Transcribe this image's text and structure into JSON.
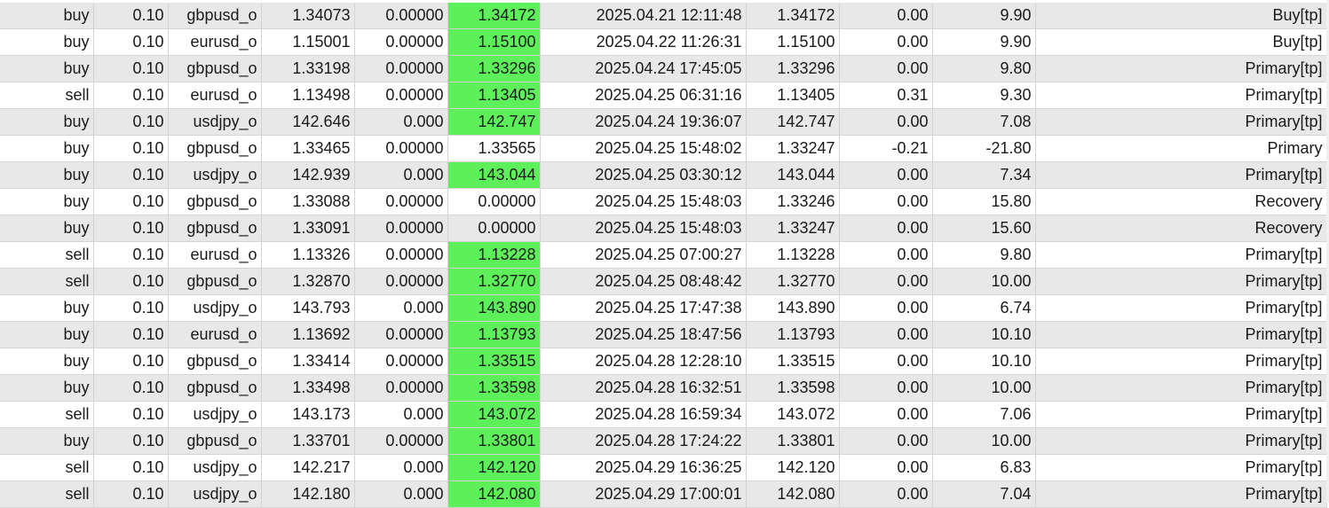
{
  "highlight_color": "#5ef05a",
  "rows": [
    {
      "type": "buy",
      "volume": "0.10",
      "symbol": "gbpusd_o",
      "price": "1.34073",
      "sl": "0.00000",
      "tp": "1.34172",
      "tp_hit": true,
      "time": "2025.04.21 12:11:48",
      "close_price": "1.34172",
      "swap": "0.00",
      "profit": "9.90",
      "comment": "Buy[tp]"
    },
    {
      "type": "buy",
      "volume": "0.10",
      "symbol": "eurusd_o",
      "price": "1.15001",
      "sl": "0.00000",
      "tp": "1.15100",
      "tp_hit": true,
      "time": "2025.04.22 11:26:31",
      "close_price": "1.15100",
      "swap": "0.00",
      "profit": "9.90",
      "comment": "Buy[tp]"
    },
    {
      "type": "buy",
      "volume": "0.10",
      "symbol": "gbpusd_o",
      "price": "1.33198",
      "sl": "0.00000",
      "tp": "1.33296",
      "tp_hit": true,
      "time": "2025.04.24 17:45:05",
      "close_price": "1.33296",
      "swap": "0.00",
      "profit": "9.80",
      "comment": "Primary[tp]"
    },
    {
      "type": "sell",
      "volume": "0.10",
      "symbol": "eurusd_o",
      "price": "1.13498",
      "sl": "0.00000",
      "tp": "1.13405",
      "tp_hit": true,
      "time": "2025.04.25 06:31:16",
      "close_price": "1.13405",
      "swap": "0.31",
      "profit": "9.30",
      "comment": "Primary[tp]"
    },
    {
      "type": "buy",
      "volume": "0.10",
      "symbol": "usdjpy_o",
      "price": "142.646",
      "sl": "0.000",
      "tp": "142.747",
      "tp_hit": true,
      "time": "2025.04.24 19:36:07",
      "close_price": "142.747",
      "swap": "0.00",
      "profit": "7.08",
      "comment": "Primary[tp]"
    },
    {
      "type": "buy",
      "volume": "0.10",
      "symbol": "gbpusd_o",
      "price": "1.33465",
      "sl": "0.00000",
      "tp": "1.33565",
      "tp_hit": false,
      "time": "2025.04.25 15:48:02",
      "close_price": "1.33247",
      "swap": "-0.21",
      "profit": "-21.80",
      "comment": "Primary"
    },
    {
      "type": "buy",
      "volume": "0.10",
      "symbol": "usdjpy_o",
      "price": "142.939",
      "sl": "0.000",
      "tp": "143.044",
      "tp_hit": true,
      "time": "2025.04.25 03:30:12",
      "close_price": "143.044",
      "swap": "0.00",
      "profit": "7.34",
      "comment": "Primary[tp]"
    },
    {
      "type": "buy",
      "volume": "0.10",
      "symbol": "gbpusd_o",
      "price": "1.33088",
      "sl": "0.00000",
      "tp": "0.00000",
      "tp_hit": false,
      "time": "2025.04.25 15:48:03",
      "close_price": "1.33246",
      "swap": "0.00",
      "profit": "15.80",
      "comment": "Recovery"
    },
    {
      "type": "buy",
      "volume": "0.10",
      "symbol": "gbpusd_o",
      "price": "1.33091",
      "sl": "0.00000",
      "tp": "0.00000",
      "tp_hit": false,
      "time": "2025.04.25 15:48:03",
      "close_price": "1.33247",
      "swap": "0.00",
      "profit": "15.60",
      "comment": "Recovery"
    },
    {
      "type": "sell",
      "volume": "0.10",
      "symbol": "eurusd_o",
      "price": "1.13326",
      "sl": "0.00000",
      "tp": "1.13228",
      "tp_hit": true,
      "time": "2025.04.25 07:00:27",
      "close_price": "1.13228",
      "swap": "0.00",
      "profit": "9.80",
      "comment": "Primary[tp]"
    },
    {
      "type": "sell",
      "volume": "0.10",
      "symbol": "gbpusd_o",
      "price": "1.32870",
      "sl": "0.00000",
      "tp": "1.32770",
      "tp_hit": true,
      "time": "2025.04.25 08:48:42",
      "close_price": "1.32770",
      "swap": "0.00",
      "profit": "10.00",
      "comment": "Primary[tp]"
    },
    {
      "type": "buy",
      "volume": "0.10",
      "symbol": "usdjpy_o",
      "price": "143.793",
      "sl": "0.000",
      "tp": "143.890",
      "tp_hit": true,
      "time": "2025.04.25 17:47:38",
      "close_price": "143.890",
      "swap": "0.00",
      "profit": "6.74",
      "comment": "Primary[tp]"
    },
    {
      "type": "buy",
      "volume": "0.10",
      "symbol": "eurusd_o",
      "price": "1.13692",
      "sl": "0.00000",
      "tp": "1.13793",
      "tp_hit": true,
      "time": "2025.04.25 18:47:56",
      "close_price": "1.13793",
      "swap": "0.00",
      "profit": "10.10",
      "comment": "Primary[tp]"
    },
    {
      "type": "buy",
      "volume": "0.10",
      "symbol": "gbpusd_o",
      "price": "1.33414",
      "sl": "0.00000",
      "tp": "1.33515",
      "tp_hit": true,
      "time": "2025.04.28 12:28:10",
      "close_price": "1.33515",
      "swap": "0.00",
      "profit": "10.10",
      "comment": "Primary[tp]"
    },
    {
      "type": "buy",
      "volume": "0.10",
      "symbol": "gbpusd_o",
      "price": "1.33498",
      "sl": "0.00000",
      "tp": "1.33598",
      "tp_hit": true,
      "time": "2025.04.28 16:32:51",
      "close_price": "1.33598",
      "swap": "0.00",
      "profit": "10.00",
      "comment": "Primary[tp]"
    },
    {
      "type": "sell",
      "volume": "0.10",
      "symbol": "usdjpy_o",
      "price": "143.173",
      "sl": "0.000",
      "tp": "143.072",
      "tp_hit": true,
      "time": "2025.04.28 16:59:34",
      "close_price": "143.072",
      "swap": "0.00",
      "profit": "7.06",
      "comment": "Primary[tp]"
    },
    {
      "type": "buy",
      "volume": "0.10",
      "symbol": "gbpusd_o",
      "price": "1.33701",
      "sl": "0.00000",
      "tp": "1.33801",
      "tp_hit": true,
      "time": "2025.04.28 17:24:22",
      "close_price": "1.33801",
      "swap": "0.00",
      "profit": "10.00",
      "comment": "Primary[tp]"
    },
    {
      "type": "sell",
      "volume": "0.10",
      "symbol": "usdjpy_o",
      "price": "142.217",
      "sl": "0.000",
      "tp": "142.120",
      "tp_hit": true,
      "time": "2025.04.29 16:36:25",
      "close_price": "142.120",
      "swap": "0.00",
      "profit": "6.83",
      "comment": "Primary[tp]"
    },
    {
      "type": "sell",
      "volume": "0.10",
      "symbol": "usdjpy_o",
      "price": "142.180",
      "sl": "0.000",
      "tp": "142.080",
      "tp_hit": true,
      "time": "2025.04.29 17:00:01",
      "close_price": "142.080",
      "swap": "0.00",
      "profit": "7.04",
      "comment": "Primary[tp]"
    }
  ]
}
